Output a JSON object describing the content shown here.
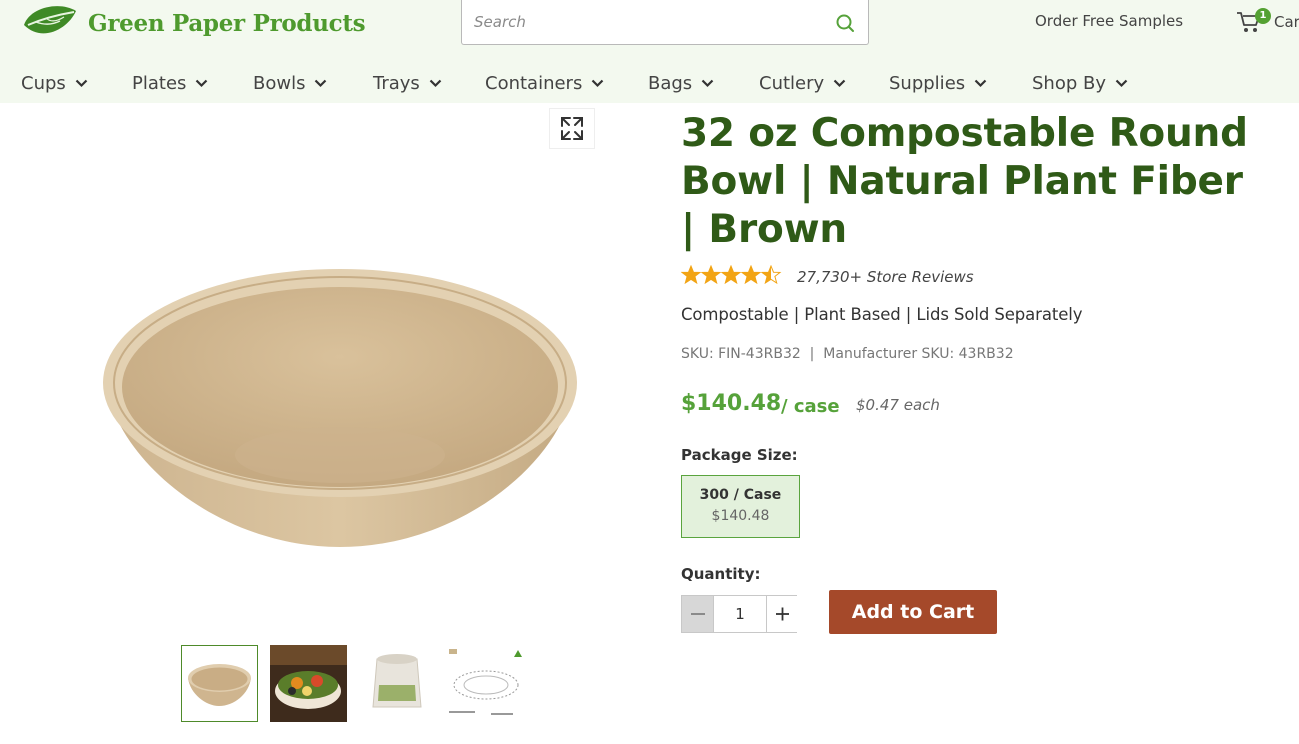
{
  "brand": {
    "name": "Green Paper Products",
    "color": "#4e9a2e"
  },
  "search": {
    "placeholder": "Search"
  },
  "header": {
    "samples_label": "Order Free Samples",
    "cart_count": "1",
    "cart_label": "Cart"
  },
  "nav": {
    "items": [
      {
        "label": "Cups"
      },
      {
        "label": "Plates"
      },
      {
        "label": "Bowls"
      },
      {
        "label": "Trays"
      },
      {
        "label": "Containers"
      },
      {
        "label": "Bags"
      },
      {
        "label": "Cutlery"
      },
      {
        "label": "Supplies"
      },
      {
        "label": "Shop By"
      }
    ]
  },
  "product": {
    "title": "32 oz Compostable Round Bowl | Natural Plant Fiber | Brown",
    "rating": 4.5,
    "reviews_label": "27,730+ Store Reviews",
    "tagline": "Compostable | Plant Based | Lids Sold Separately",
    "sku_line": "SKU: FIN-43RB32  |  Manufacturer SKU: 43RB32",
    "price": "$140.48",
    "price_unit": "/ case",
    "price_each": "$0.47 each",
    "package_size_label": "Package Size:",
    "package_options": [
      {
        "name": "300 / Case",
        "price": "$140.48",
        "selected": true
      }
    ],
    "quantity_label": "Quantity:",
    "quantity": "1",
    "add_to_cart_label": "Add to Cart"
  },
  "gallery": {
    "thumbnails": [
      "bowl-photo",
      "salad-bowl-photo",
      "packaged-bowls-photo",
      "bowl-diagram"
    ],
    "selected_index": 0
  },
  "colors": {
    "accent_green": "#56a23a",
    "title_green": "#2f5a17",
    "cart_button": "#a5492a",
    "star": "#f2a414"
  }
}
